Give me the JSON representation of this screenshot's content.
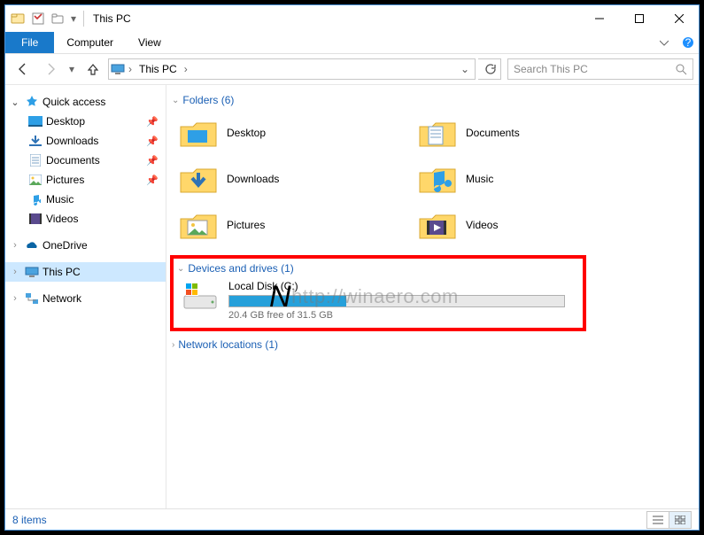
{
  "window": {
    "title": "This PC"
  },
  "ribbon": {
    "file": "File",
    "tabs": [
      "Computer",
      "View"
    ]
  },
  "nav": {
    "address_icon": "pc",
    "crumb": "This PC",
    "search_placeholder": "Search This PC"
  },
  "tree": {
    "quick_access": {
      "label": "Quick access",
      "items": [
        {
          "label": "Desktop",
          "icon": "desktop",
          "pinned": true
        },
        {
          "label": "Downloads",
          "icon": "downloads",
          "pinned": true
        },
        {
          "label": "Documents",
          "icon": "documents",
          "pinned": true
        },
        {
          "label": "Pictures",
          "icon": "pictures",
          "pinned": true
        },
        {
          "label": "Music",
          "icon": "music",
          "pinned": false
        },
        {
          "label": "Videos",
          "icon": "videos",
          "pinned": false
        }
      ]
    },
    "onedrive": {
      "label": "OneDrive"
    },
    "this_pc": {
      "label": "This PC"
    },
    "network": {
      "label": "Network"
    }
  },
  "sections": {
    "folders": {
      "title": "Folders (6)",
      "items": [
        {
          "label": "Desktop",
          "icon": "desktop-folder"
        },
        {
          "label": "Documents",
          "icon": "documents-folder"
        },
        {
          "label": "Downloads",
          "icon": "downloads-folder"
        },
        {
          "label": "Music",
          "icon": "music-folder"
        },
        {
          "label": "Pictures",
          "icon": "pictures-folder"
        },
        {
          "label": "Videos",
          "icon": "videos-folder"
        }
      ]
    },
    "drives": {
      "title": "Devices and drives (1)",
      "items": [
        {
          "label": "Local Disk (C:)",
          "free_text": "20.4 GB free of 31.5 GB",
          "used_pct": 35
        }
      ]
    },
    "network": {
      "title": "Network locations (1)"
    }
  },
  "status": {
    "count": "8 items"
  },
  "watermark": "http://winaero.com"
}
